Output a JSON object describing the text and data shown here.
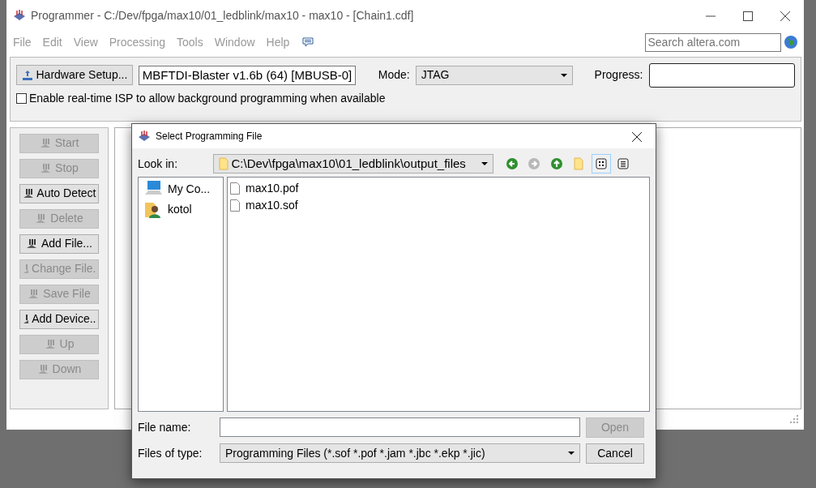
{
  "window": {
    "title": "Programmer - C:/Dev/fpga/max10/01_ledblink/max10 - max10 - [Chain1.cdf]"
  },
  "menu": [
    "File",
    "Edit",
    "View",
    "Processing",
    "Tools",
    "Window",
    "Help"
  ],
  "search": {
    "placeholder": "Search altera.com"
  },
  "toolbar": {
    "hardware_button": "Hardware Setup...",
    "hardware_value": "MBFTDI-Blaster v1.6b (64) [MBUSB-0]",
    "mode_label": "Mode:",
    "mode_value": "JTAG",
    "progress_label": "Progress:",
    "progress": {
      "level": 0
    },
    "isp_label": "Enable real-time ISP to allow background programming when available",
    "isp_checked": false
  },
  "side_buttons": [
    {
      "label": "Start",
      "disabled": true
    },
    {
      "label": "Stop",
      "disabled": true
    },
    {
      "label": "Auto Detect",
      "disabled": false
    },
    {
      "label": "Delete",
      "disabled": true
    },
    {
      "label": "Add File...",
      "disabled": false
    },
    {
      "label": "Change File.",
      "disabled": true
    },
    {
      "label": "Save File",
      "disabled": true
    },
    {
      "label": "Add Device..",
      "disabled": false
    },
    {
      "label": "Up",
      "disabled": true
    },
    {
      "label": "Down",
      "disabled": true
    }
  ],
  "dialog": {
    "title": "Select Programming File",
    "look_in_label": "Look in:",
    "look_in_value": "C:\\Dev\\fpga\\max10\\01_ledblink\\output_files",
    "nav": [
      {
        "kind": "back",
        "disabled": false
      },
      {
        "kind": "forward",
        "disabled": true
      },
      {
        "kind": "up",
        "disabled": false
      },
      {
        "kind": "newfolder"
      },
      {
        "kind": "listview",
        "selected": true
      },
      {
        "kind": "detailview",
        "selected": false
      }
    ],
    "places": [
      {
        "kind": "computer",
        "label": "My Co..."
      },
      {
        "kind": "user",
        "label": "kotol"
      }
    ],
    "files": [
      "max10.pof",
      "max10.sof"
    ],
    "file_name_label": "File name:",
    "open_button": "Open",
    "open_disabled": true,
    "type_label": "Files of type:",
    "type_value": "Programming Files (*.sof *.pof *.jam *.jbc *.ekp *.jic)",
    "cancel_button": "Cancel"
  }
}
